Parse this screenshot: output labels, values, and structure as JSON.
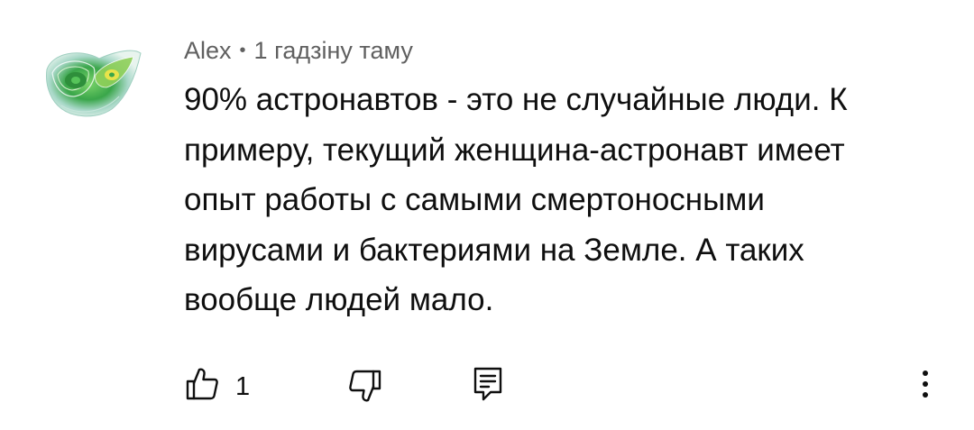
{
  "comment": {
    "author": "Alex",
    "separator": "•",
    "timestamp": "1 гадзіну таму",
    "text_lines": [
      "90% астронавтов - это не случайные люди. К",
      "примеру, текущий женщина-астронавт имеет",
      "опыт работы с самыми смертоносными",
      "вирусами и бактериями на Земле. А таких",
      "вообще людей мало."
    ]
  },
  "actions": {
    "like_count": "1",
    "like_icon": "thumb-up-icon",
    "dislike_icon": "thumb-down-icon",
    "reply_icon": "reply-icon",
    "more_icon": "more-vert-icon"
  },
  "colors": {
    "text_primary": "#0f0f0f",
    "text_secondary": "#606060",
    "avatar_green": "#3aa64a",
    "avatar_yellow": "#e8e34a"
  }
}
